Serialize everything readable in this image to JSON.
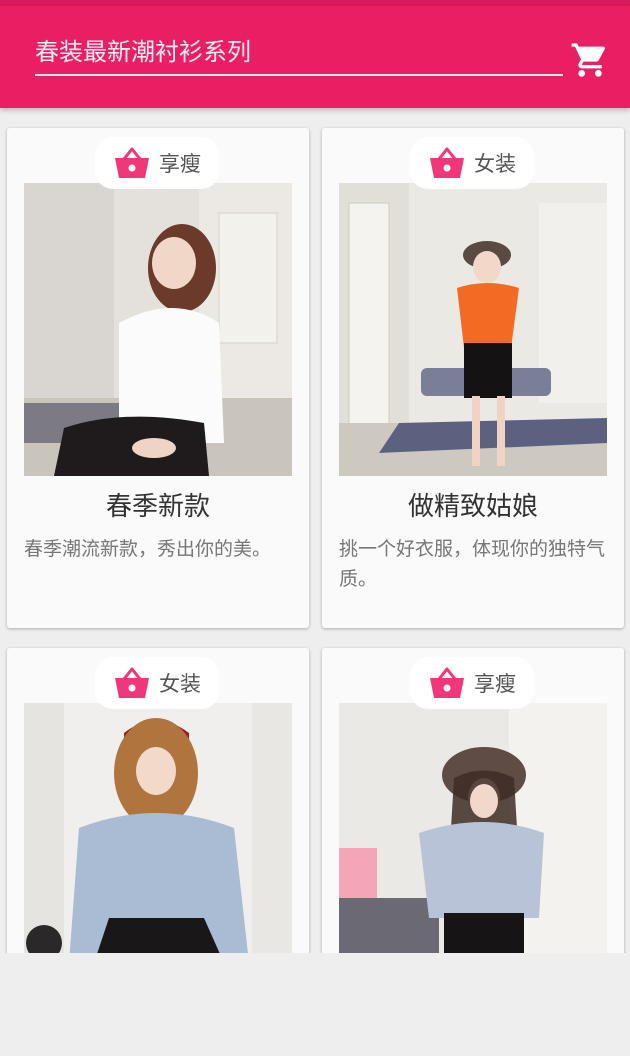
{
  "header": {
    "search_placeholder": "春装最新潮衬衫系列",
    "cart_icon": "shopping-cart-icon"
  },
  "colors": {
    "primary": "#ea1e63",
    "accent_pink": "#f0377b",
    "card_bg": "#fafafa",
    "page_bg": "#eeeeee"
  },
  "cards": [
    {
      "tag": "享瘦",
      "title": "春季新款",
      "desc": "春季潮流新款，秀出你的美。"
    },
    {
      "tag": "女装",
      "title": "做精致姑娘",
      "desc": "挑一个好衣服，体现你的独特气质。"
    },
    {
      "tag": "女装"
    },
    {
      "tag": "享瘦"
    }
  ]
}
